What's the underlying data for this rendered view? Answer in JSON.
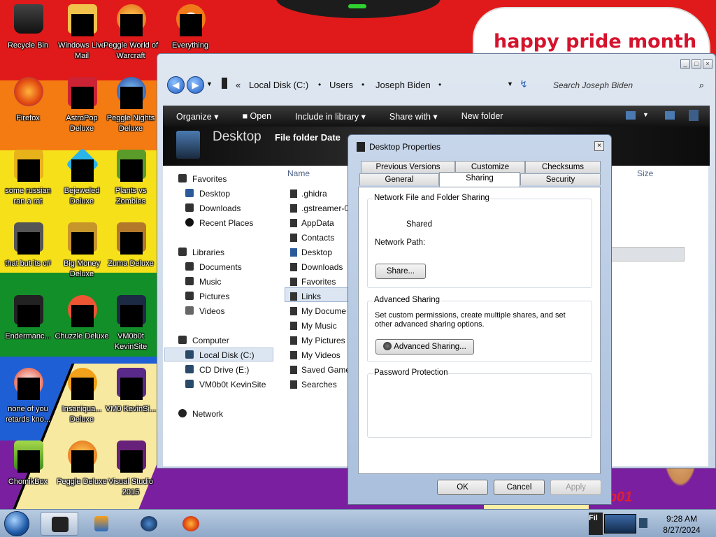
{
  "desktop": {
    "wallpaper_text": "happy pride month",
    "wallpaper_scribble": "Ybob01",
    "icons": [
      {
        "label": "Recycle Bin"
      },
      {
        "label": "Windows Live Mail"
      },
      {
        "label": "Peggle World of Warcraft"
      },
      {
        "label": "Everything"
      },
      {
        "label": "Firefox"
      },
      {
        "label": "AstroPop Deluxe"
      },
      {
        "label": "Peggle Nights Deluxe"
      },
      {
        "label": "some russian ran a rat"
      },
      {
        "label": "Bejeweled Deluxe"
      },
      {
        "label": "Plants vs Zombies"
      },
      {
        "label": "that but its c#"
      },
      {
        "label": "Big Money Deluxe"
      },
      {
        "label": "Zuma Deluxe"
      },
      {
        "label": "Endermanc..."
      },
      {
        "label": "Chuzzle Deluxe"
      },
      {
        "label": "VM0b0t KevinSite"
      },
      {
        "label": "none of you retards kno..."
      },
      {
        "label": "Insaniqua... Deluxe"
      },
      {
        "label": "VM0 KevinSi..."
      },
      {
        "label": "ChomikBox"
      },
      {
        "label": "Peggle Deluxe"
      },
      {
        "label": "Visual Studio 2015"
      }
    ]
  },
  "explorer": {
    "breadcrumb": [
      "«",
      "Local Disk (C:)",
      "Users",
      "Joseph Biden"
    ],
    "search_placeholder": "Search Joseph Biden",
    "window_controls": [
      "_",
      "□",
      "×"
    ],
    "toolbar": {
      "organize": "Organize",
      "open": "Open",
      "include": "Include in library",
      "share": "Share with",
      "new_folder": "New folder"
    },
    "header": {
      "title": "Desktop",
      "subtitle": "File folder  Date"
    },
    "nav": {
      "favorites": "Favorites",
      "desktop": "Desktop",
      "downloads": "Downloads",
      "recent": "Recent Places",
      "libraries": "Libraries",
      "documents": "Documents",
      "music": "Music",
      "pictures": "Pictures",
      "videos": "Videos",
      "computer": "Computer",
      "local_disk": "Local Disk (C:)",
      "cd_drive": "CD Drive (E:)",
      "vm": "VM0b0t KevinSite",
      "network": "Network"
    },
    "columns": {
      "name": "Name",
      "size": "Size"
    },
    "files": [
      ".ghidra",
      ".gstreamer-0",
      "AppData",
      "Contacts",
      "Desktop",
      "Downloads",
      "Favorites",
      "Links",
      "My Docume",
      "My Music",
      "My Pictures",
      "My Videos",
      "Saved Game",
      "Searches"
    ]
  },
  "dialog": {
    "title": "Desktop Properties",
    "close": "×",
    "tabs": {
      "previous_versions": "Previous Versions",
      "customize": "Customize",
      "checksums": "Checksums",
      "general": "General",
      "sharing": "Sharing",
      "security": "Security"
    },
    "network_group": {
      "title": "Network File and Folder Sharing",
      "status": "Shared",
      "path_label": "Network Path:",
      "share_button": "Share..."
    },
    "advanced_group": {
      "title": "Advanced Sharing",
      "description": "Set custom permissions, create multiple shares, and set other advanced sharing options.",
      "button": "Advanced Sharing..."
    },
    "password_group": {
      "title": "Password Protection"
    },
    "buttons": {
      "ok": "OK",
      "cancel": "Cancel",
      "apply": "Apply"
    }
  },
  "taskbar": {
    "tray_label": "Fil",
    "time": "9:28 AM",
    "date": "8/27/2024"
  }
}
